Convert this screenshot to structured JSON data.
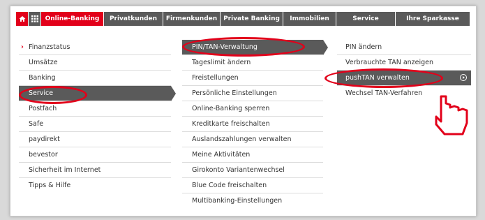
{
  "topnav": {
    "home_icon": "home-icon",
    "grid_icon": "grid-icon",
    "tabs": [
      {
        "label": "Online-Banking"
      },
      {
        "label": "Privatkunden"
      },
      {
        "label": "Firmenkunden"
      },
      {
        "label": "Private Banking"
      },
      {
        "label": "Immobilien"
      },
      {
        "label": "Service"
      },
      {
        "label": "Ihre Sparkasse"
      }
    ]
  },
  "menu_level1": {
    "items": [
      {
        "label": "Finanzstatus"
      },
      {
        "label": "Umsätze"
      },
      {
        "label": "Banking"
      },
      {
        "label": "Service"
      },
      {
        "label": "Postfach"
      },
      {
        "label": "Safe"
      },
      {
        "label": "paydirekt"
      },
      {
        "label": "bevestor"
      },
      {
        "label": "Sicherheit im Internet"
      },
      {
        "label": "Tipps & Hilfe"
      }
    ],
    "current_marker": "›"
  },
  "menu_level2": {
    "items": [
      {
        "label": "PIN/TAN-Verwaltung"
      },
      {
        "label": "Tageslimit ändern"
      },
      {
        "label": "Freistellungen"
      },
      {
        "label": "Persönliche Einstellungen"
      },
      {
        "label": "Online-Banking sperren"
      },
      {
        "label": "Kreditkarte freischalten"
      },
      {
        "label": "Auslandszahlungen verwalten"
      },
      {
        "label": "Meine Aktivitäten"
      },
      {
        "label": "Girokonto Variantenwechsel"
      },
      {
        "label": "Blue Code freischalten"
      },
      {
        "label": "Multibanking-Einstellungen"
      }
    ]
  },
  "menu_level3": {
    "items": [
      {
        "label": "PIN ändern"
      },
      {
        "label": "Verbrauchte TAN anzeigen"
      },
      {
        "label": "pushTAN verwalten"
      },
      {
        "label": "Wechsel TAN-Verfahren"
      }
    ]
  },
  "colors": {
    "brand_red": "#e2001a",
    "nav_gray": "#5a5a5a",
    "highlight": "#e2001a"
  }
}
